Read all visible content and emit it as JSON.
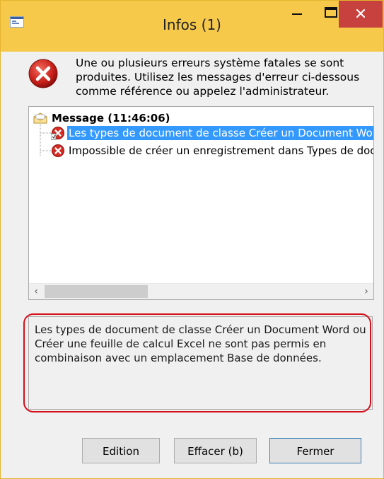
{
  "window": {
    "title": "Infos (1)",
    "accent_color": "#f6c94b",
    "close_color": "#c7413e"
  },
  "message": {
    "intro": "Une ou plusieurs erreurs système fatales se sont produites. Utilisez les messages d'erreur ci-dessous comme référence ou appelez l'administrateur."
  },
  "tree": {
    "root_label": "Message (11:46:06)",
    "items": [
      {
        "label": "Les types de document de classe Créer un Document Word ou Créer une feuille de calcul Excel ne sont pas permis en combinaison avec un emplacement Base de données.",
        "icon": "error-icon",
        "selected": true
      },
      {
        "label": "Impossible de créer un enregistrement dans Types de document (DocuType).",
        "icon": "error-icon",
        "selected": false
      }
    ],
    "scroll_left_glyph": "‹",
    "scroll_right_glyph": "›"
  },
  "splitter_glyph": "....",
  "detail": {
    "text": "Les types de document de classe Créer un Document Word ou Créer une feuille de calcul Excel ne sont pas permis en combinaison avec un emplacement Base de données."
  },
  "buttons": {
    "edit": "Edition",
    "clear": "Effacer (b)",
    "close": "Fermer"
  }
}
